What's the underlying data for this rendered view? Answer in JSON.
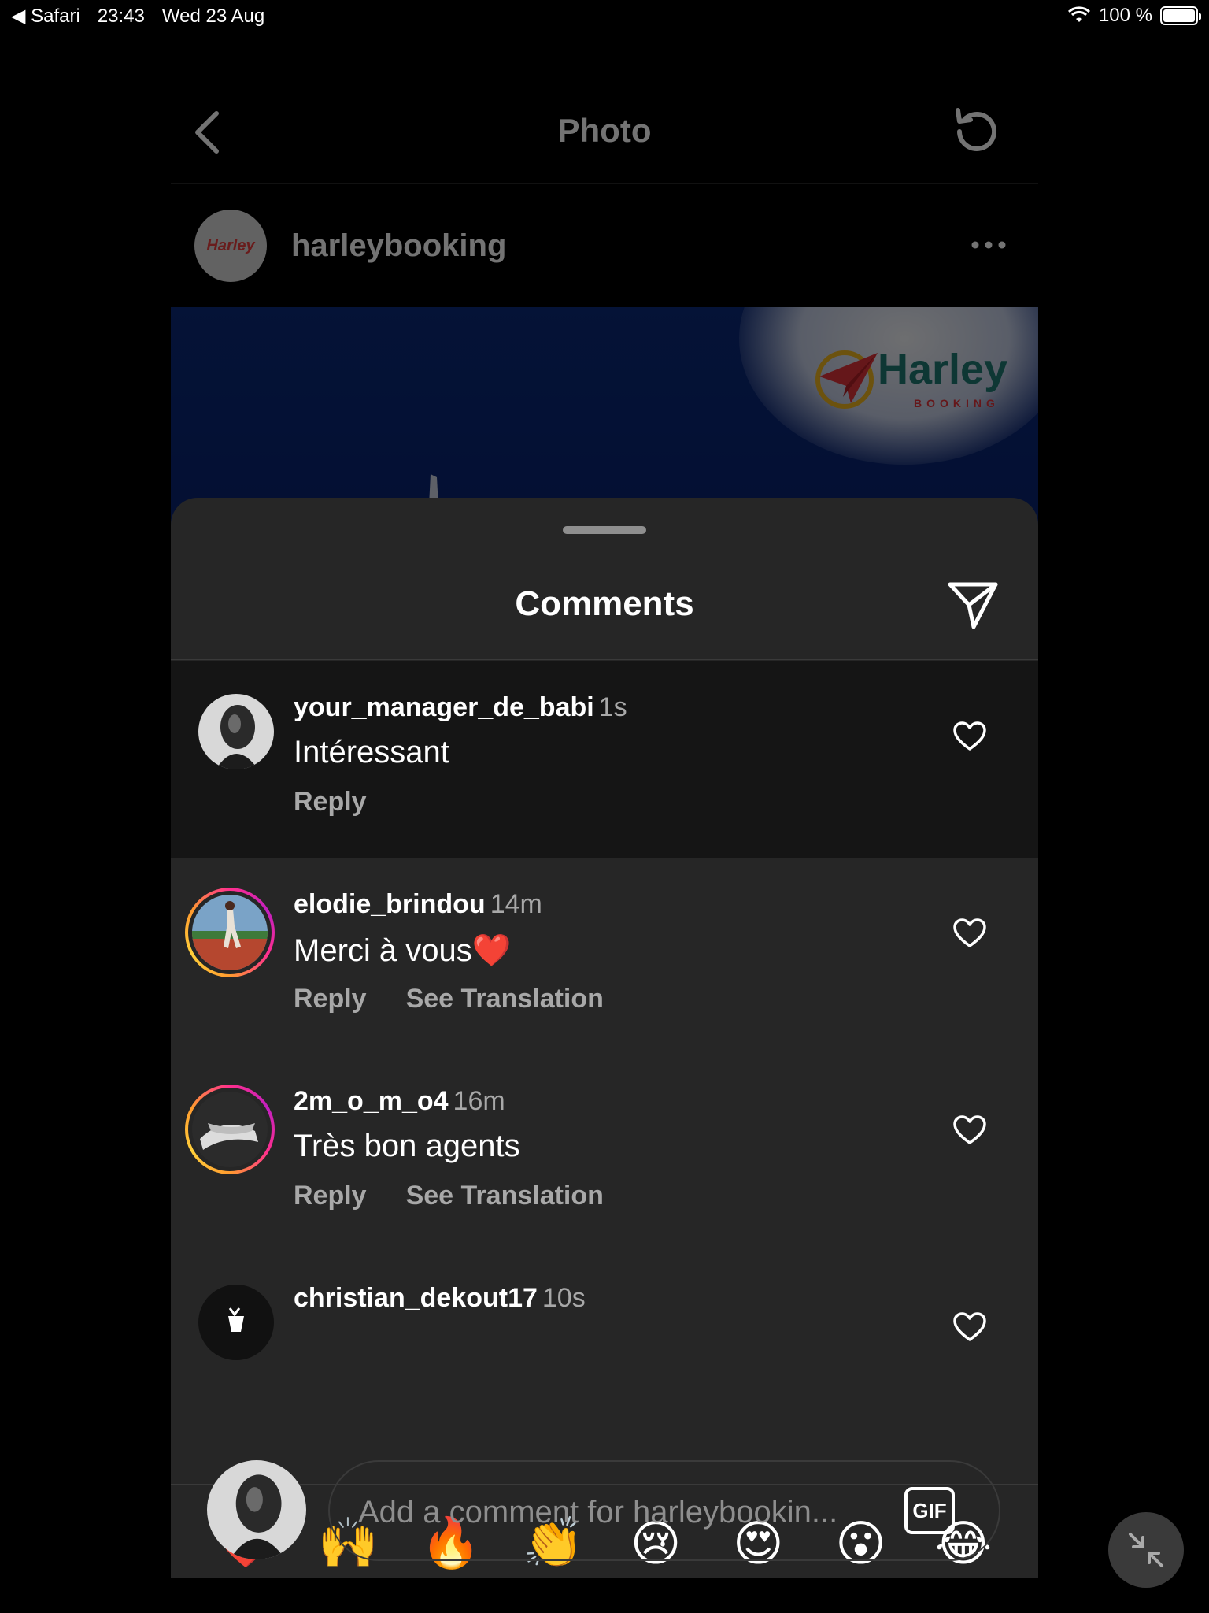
{
  "status_bar": {
    "back_app": "◀ Safari",
    "time": "23:43",
    "date": "Wed 23 Aug",
    "battery": "100 %"
  },
  "topbar": {
    "title": "Photo"
  },
  "post": {
    "username": "harleybooking",
    "avatar_text": "Harley",
    "logo_text": "Harley",
    "logo_sub": "BOOKING"
  },
  "sheet": {
    "title": "Comments"
  },
  "comments": [
    {
      "user": "your_manager_de_babi",
      "time": "1s",
      "text": "Intéressant",
      "reply": "Reply"
    },
    {
      "user": "elodie_brindou",
      "time": "14m",
      "text": "Merci à vous❤️",
      "reply": "Reply",
      "translate": "See Translation"
    },
    {
      "user": "2m_o_m_o4",
      "time": "16m",
      "text": "Très bon agents",
      "reply": "Reply",
      "translate": "See Translation"
    },
    {
      "user": "christian_dekout17",
      "time": "10s"
    }
  ],
  "emojis": [
    "❤️",
    "🙌",
    "🔥",
    "👏",
    "😢",
    "😍",
    "😮",
    "😂"
  ],
  "composer": {
    "placeholder": "Add a comment for harleybookin...",
    "gif_label": "GIF"
  },
  "colors": {
    "sheet_bg": "#262626",
    "highlight_bg": "#151515",
    "muted_text": "#a8a8a8"
  }
}
